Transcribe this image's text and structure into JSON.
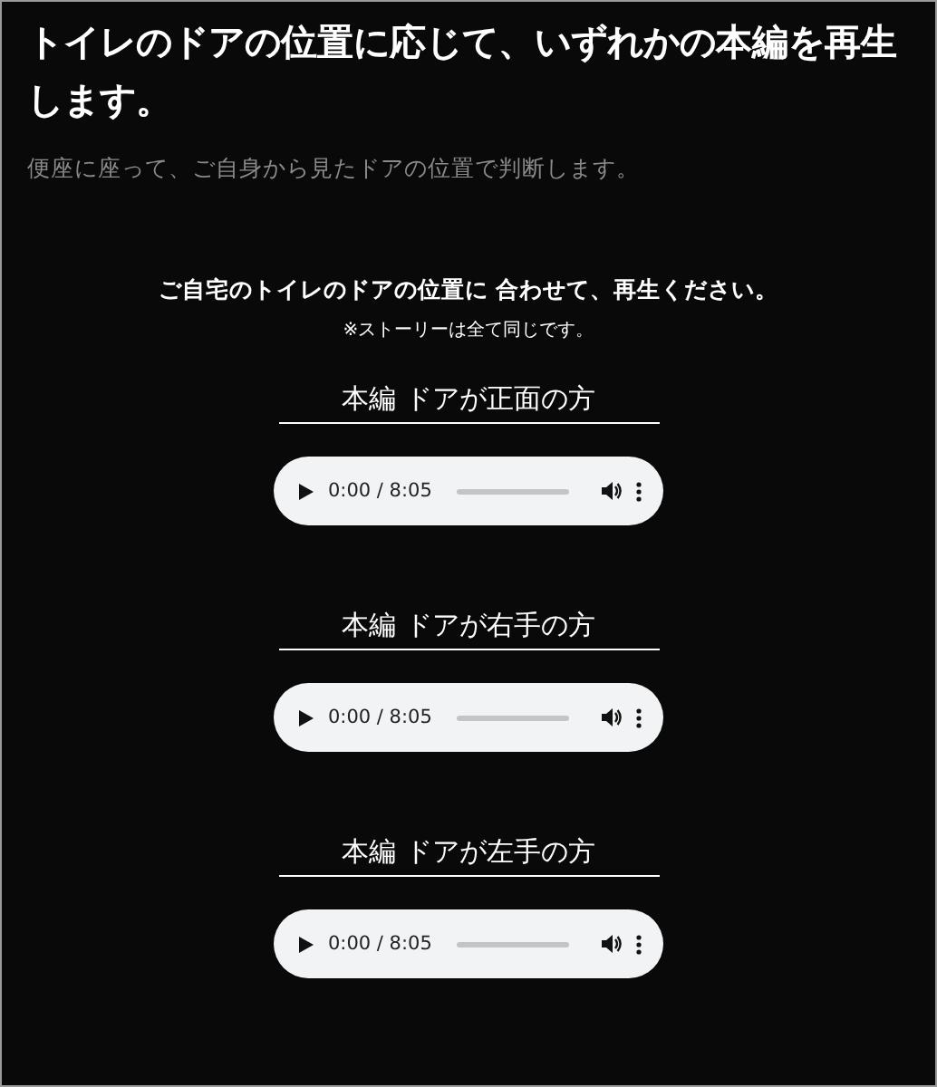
{
  "heading": "トイレのドアの位置に応じて、いずれかの本編を再生します。",
  "subtitle": "便座に座って、ご自身から見たドアの位置で判断します。",
  "instruction": "ご自宅のトイレのドアの位置に 合わせて、再生ください。",
  "note": "※ストーリーは全て同じです。",
  "episodes": [
    {
      "title": "本編 ドアが正面の方",
      "player": {
        "time": "0:00 / 8:05"
      }
    },
    {
      "title": "本編 ドアが右手の方",
      "player": {
        "time": "0:00 / 8:05"
      }
    },
    {
      "title": "本編 ドアが左手の方",
      "player": {
        "time": "0:00 / 8:05"
      }
    }
  ]
}
